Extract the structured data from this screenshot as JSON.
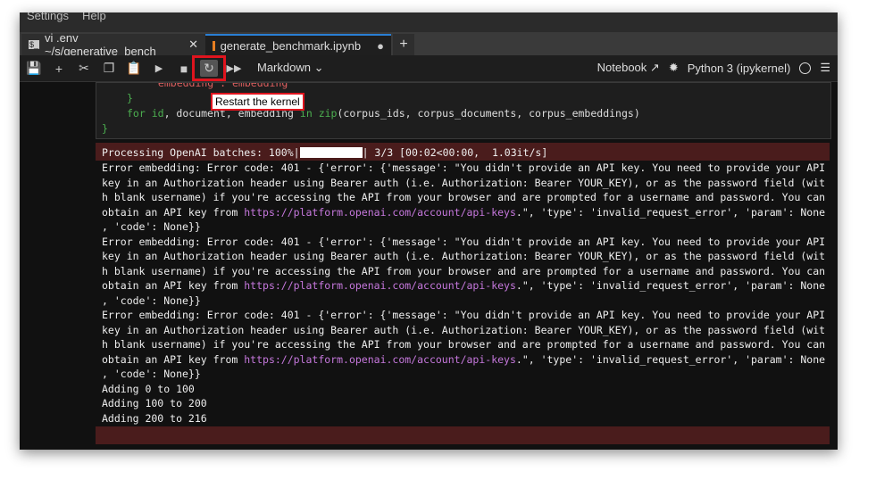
{
  "menu": [
    "Settings",
    "Help"
  ],
  "tabs": [
    {
      "label": "vi .env ~/s/generative_bench",
      "close": "✕"
    },
    {
      "label": "generate_benchmark.ipynb",
      "modified": "●"
    }
  ],
  "add_tab": "+",
  "toolbar": {
    "cell_type": "Markdown",
    "notebook": "Notebook",
    "kernel": "Python 3 (ipykernel)",
    "tooltip": "Restart the kernel"
  },
  "code": {
    "line0": "\"embedding\": embedding",
    "line1": "}",
    "for": "for",
    "id": "id",
    "mid": ", document, embedding ",
    "in": "in",
    "zip": "zip",
    "rest": "(corpus_ids, corpus_documents, corpus_embeddings)",
    "line3": "}"
  },
  "output": {
    "progress_pre": "Processing OpenAI batches: 100%|",
    "progress_post": "| 3/3 [00:02<00:00,  1.03it/s]",
    "error": {
      "l1": "Error embedding: Error code: 401 - {'error': {'message': \"You didn't provide an API key. You need to provide your API",
      "l2": "key in an Authorization header using Bearer auth (i.e. Authorization: Bearer YOUR_KEY), or as the password field (wit",
      "l3": "h blank username) if you're accessing the API from your browser and are prompted for a username and password. You can",
      "l4a": "obtain an API key from ",
      "link": "https://platform.openai.com/account/api-keys",
      "l4b": ".\", 'type': 'invalid_request_error', 'param': None",
      "l5": ", 'code': None}}"
    },
    "adding": [
      "Adding 0 to 100",
      "Adding 100 to 200",
      "Adding 200 to 216"
    ]
  },
  "colors": {
    "accent": "#2a7fd4",
    "error_bg": "#4a1c1c",
    "link": "#c678dd",
    "highlight": "#e0141e"
  }
}
